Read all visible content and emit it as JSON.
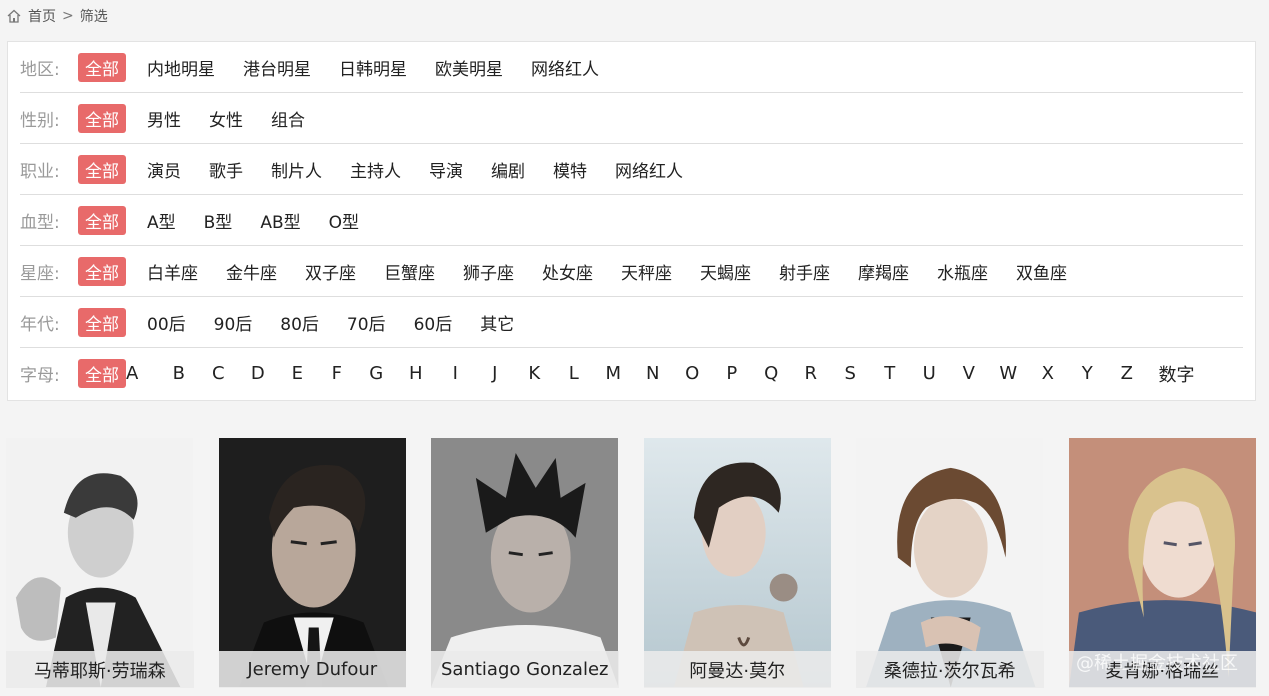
{
  "breadcrumb": {
    "home": "首页",
    "separator": ">",
    "current": "筛选"
  },
  "filters": [
    {
      "label": "地区:",
      "all": "全部",
      "options": [
        "内地明星",
        "港台明星",
        "日韩明星",
        "欧美明星",
        "网络红人"
      ]
    },
    {
      "label": "性别:",
      "all": "全部",
      "options": [
        "男性",
        "女性",
        "组合"
      ]
    },
    {
      "label": "职业:",
      "all": "全部",
      "options": [
        "演员",
        "歌手",
        "制片人",
        "主持人",
        "导演",
        "编剧",
        "模特",
        "网络红人"
      ]
    },
    {
      "label": "血型:",
      "all": "全部",
      "options": [
        "A型",
        "B型",
        "AB型",
        "O型"
      ]
    },
    {
      "label": "星座:",
      "all": "全部",
      "options": [
        "白羊座",
        "金牛座",
        "双子座",
        "巨蟹座",
        "狮子座",
        "处女座",
        "天秤座",
        "天蝎座",
        "射手座",
        "摩羯座",
        "水瓶座",
        "双鱼座"
      ]
    },
    {
      "label": "年代:",
      "all": "全部",
      "options": [
        "00后",
        "90后",
        "80后",
        "70后",
        "60后",
        "其它"
      ]
    },
    {
      "label": "字母:",
      "all": "全部",
      "options": [
        "A",
        "B",
        "C",
        "D",
        "E",
        "F",
        "G",
        "H",
        "I",
        "J",
        "K",
        "L",
        "M",
        "N",
        "O",
        "P",
        "Q",
        "R",
        "S",
        "T",
        "U",
        "V",
        "W",
        "X",
        "Y",
        "Z",
        "数字"
      ]
    }
  ],
  "cards": [
    {
      "name": "马蒂耶斯·劳瑞森"
    },
    {
      "name": "Jeremy Dufour"
    },
    {
      "name": "Santiago Gonzalez"
    },
    {
      "name": "阿曼达·莫尔"
    },
    {
      "name": "桑德拉·茨尔瓦希"
    },
    {
      "name": "麦肯娜·格瑞丝"
    }
  ],
  "watermark": "@稀土掘金技术社区",
  "colors": {
    "accent": "#e86a6a",
    "label": "#9a9a9a",
    "page_bg": "#f4f4f4"
  }
}
